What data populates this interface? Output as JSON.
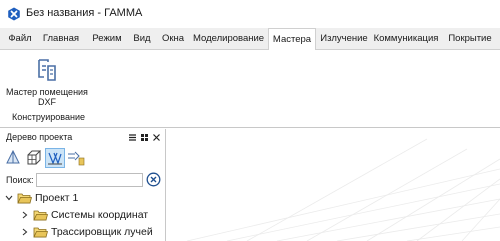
{
  "window": {
    "title": "Без названия - ГАММА",
    "app_icon": "gamma-app-icon"
  },
  "menu": {
    "items": [
      "Файл",
      "Главная",
      "Режим",
      "Вид",
      "Окна",
      "Моделирование",
      "Мастера",
      "Излучение",
      "Коммуникация",
      "Покрытие"
    ],
    "active": "Мастера"
  },
  "ribbon": {
    "button_label": "Мастер помещения DXF",
    "button_icon": "room-wizard-dxf-icon",
    "group_label": "Конструирование"
  },
  "project_panel": {
    "title": "Дерево проекта",
    "controls": [
      "menu-icon",
      "dock-grid-icon",
      "close-icon"
    ],
    "toolbar_icons": [
      "pyramid-icon",
      "grid-cube-icon",
      "axes-icon",
      "ray-tracer-icon"
    ],
    "selected_tool": "axes-icon",
    "search_label": "Поиск:",
    "search_value": "",
    "search_placeholder": "",
    "tree": {
      "root": "Проект 1",
      "children": [
        "Системы координат",
        "Трассировщик лучей"
      ]
    }
  },
  "colors": {
    "accent": "#1f5fbf",
    "folder": "#e8c55a",
    "menu_bg": "#efefef"
  }
}
